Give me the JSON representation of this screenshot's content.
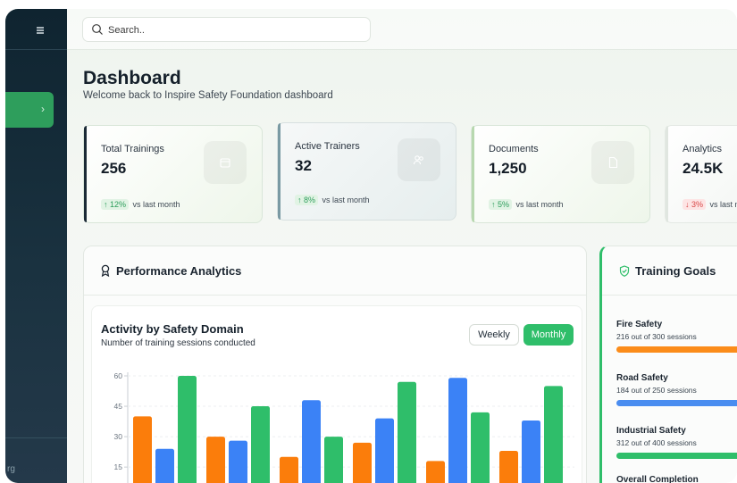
{
  "sidebar": {
    "menu_icon": "menu-icon",
    "active_icon": "chevron-right-icon",
    "footer_text": "rg"
  },
  "search": {
    "placeholder": "Search..",
    "icon": "search-icon"
  },
  "header": {
    "title": "Dashboard",
    "subtitle": "Welcome back to Inspire Safety Foundation dashboard"
  },
  "stats": [
    {
      "label": "Total Trainings",
      "value": "256",
      "trend": "↑ 12%",
      "trend_text": "vs last month",
      "trend_dir": "up",
      "accent": "#1b2a36",
      "icon": "calendar-icon"
    },
    {
      "label": "Active Trainers",
      "value": "32",
      "trend": "↑ 8%",
      "trend_text": "vs last month",
      "trend_dir": "up",
      "accent": "#7a9aa3",
      "icon": "users-icon"
    },
    {
      "label": "Documents",
      "value": "1,250",
      "trend": "↑ 5%",
      "trend_text": "vs last month",
      "trend_dir": "up",
      "accent": "#b8d8b0",
      "icon": "document-icon"
    },
    {
      "label": "Analytics",
      "value": "24.5K",
      "trend": "↓ 3%",
      "trend_text": "vs last month",
      "trend_dir": "down",
      "accent": "#e0e6e0",
      "icon": "chart-icon"
    }
  ],
  "performance": {
    "title": "Performance Analytics",
    "icon": "award-icon",
    "chart_title": "Activity by Safety Domain",
    "chart_subtitle": "Number of training sessions conducted",
    "weekly_label": "Weekly",
    "monthly_label": "Monthly",
    "selected_period": "Monthly"
  },
  "chart_data": {
    "type": "bar",
    "categories": [
      "",
      "",
      "",
      "",
      "",
      ""
    ],
    "series": [
      {
        "values": [
          40,
          30,
          20,
          27,
          18,
          23
        ],
        "color": "#fb7d0b"
      },
      {
        "values": [
          24,
          28,
          48,
          39,
          59,
          38
        ],
        "color": "#3b82f6"
      },
      {
        "values": [
          60,
          45,
          30,
          57,
          42,
          55
        ],
        "color": "#2fbe6a"
      }
    ],
    "yticks": [
      15,
      30,
      45,
      60
    ],
    "ylim": [
      0,
      60
    ],
    "grid": true
  },
  "goals": {
    "title": "Training Goals",
    "icon": "shield-check-icon",
    "items": [
      {
        "name": "Fire Safety",
        "detail": "216 out of 300 sessions",
        "progress": 0.72,
        "color": "#fb8c1a"
      },
      {
        "name": "Road Safety",
        "detail": "184 out of 250 sessions",
        "progress": 0.736,
        "color": "#4a8df0"
      },
      {
        "name": "Industrial Safety",
        "detail": "312 out of 400 sessions",
        "progress": 0.78,
        "color": "#2fbe6a"
      }
    ],
    "overall_label": "Overall Completion"
  }
}
